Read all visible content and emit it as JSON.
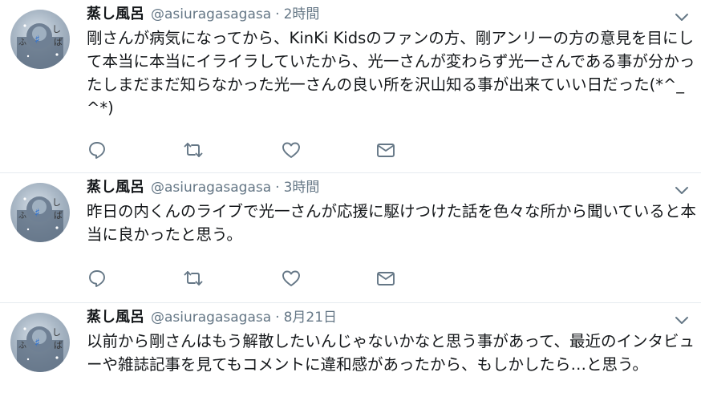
{
  "tweets": [
    {
      "name": "蒸し風呂",
      "handle": "@asiuragasagasa",
      "separator": "·",
      "time": "2時間",
      "text": "剛さんが病気になってから、KinKi Kidsのファンの方、剛アンリーの方の意見を目にして本当に本当にイライラしていたから、光一さんが変わらず光一さんである事が分かったしまだまだ知らなかった光一さんの良い所を沢山知る事が出来ていい日だった(*^_^*)"
    },
    {
      "name": "蒸し風呂",
      "handle": "@asiuragasagasa",
      "separator": "·",
      "time": "3時間",
      "text": "昨日の内くんのライブで光一さんが応援に駆けつけた話を色々な所から聞いていると本当に良かったと思う。"
    },
    {
      "name": "蒸し風呂",
      "handle": "@asiuragasagasa",
      "separator": "·",
      "time": "8月21日",
      "text": "以前から剛さんはもう解散したいんじゃないかなと思う事があって、最近のインタビューや雑誌記事を見てもコメントに違和感があったから、もしかしたら…と思う。"
    }
  ],
  "icons": {
    "caret": "chevron-down-icon",
    "reply": "reply-icon",
    "retweet": "retweet-icon",
    "like": "heart-icon",
    "message": "mail-icon"
  },
  "colors": {
    "text": "#14171a",
    "secondary": "#657786",
    "icon": "#657786",
    "divider": "#e6ecf0"
  }
}
